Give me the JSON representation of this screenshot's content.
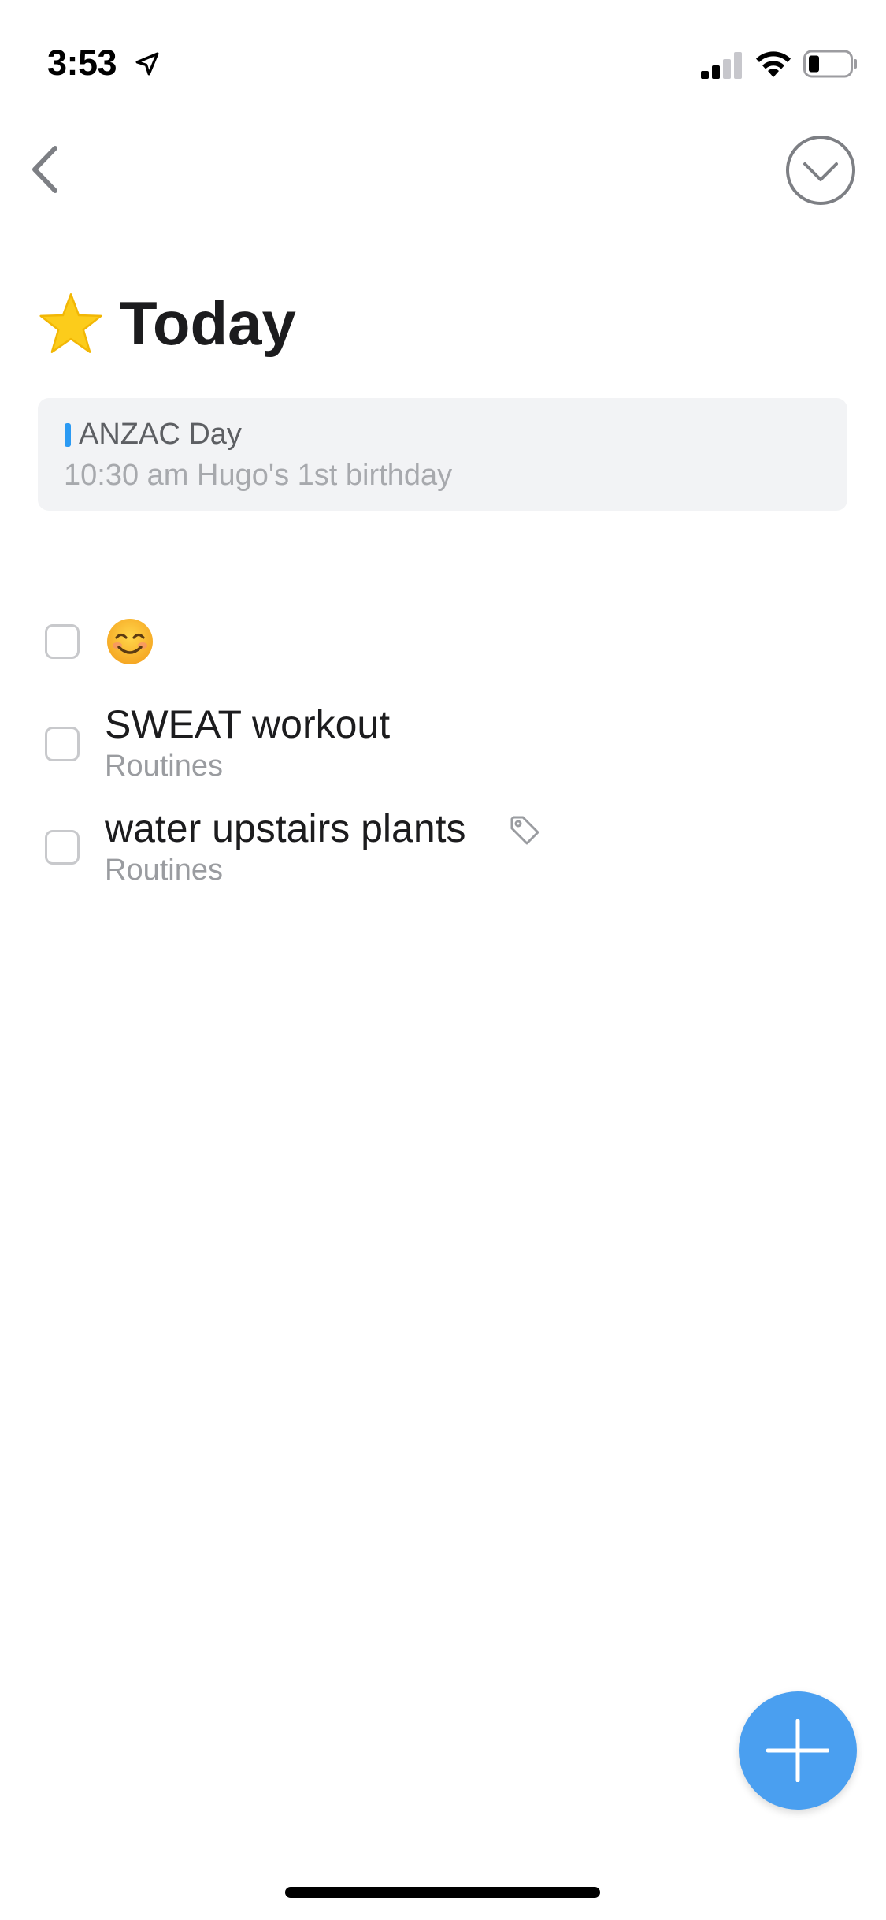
{
  "status_bar": {
    "time": "3:53",
    "location_icon": "location-arrow-icon",
    "signal_icon": "cellular-signal-icon",
    "wifi_icon": "wifi-icon",
    "battery_icon": "battery-icon"
  },
  "nav": {
    "back_icon": "chevron-left-icon",
    "menu_icon": "chevron-down-circle-icon"
  },
  "header": {
    "icon": "star-icon",
    "title": "Today"
  },
  "calendar": {
    "event": "ANZAC Day",
    "detail": "10:30 am Hugo's 1st birthday",
    "accent_color": "#2b9af3"
  },
  "tasks": [
    {
      "title": "",
      "emoji_icon": "smiling-face-emoji",
      "subtitle": ""
    },
    {
      "title": "SWEAT workout",
      "subtitle": "Routines"
    },
    {
      "title": "water upstairs plants",
      "subtitle": "Routines",
      "tag_icon": "tag-icon"
    }
  ],
  "fab": {
    "icon": "plus-icon",
    "color": "#4a9ff0"
  }
}
